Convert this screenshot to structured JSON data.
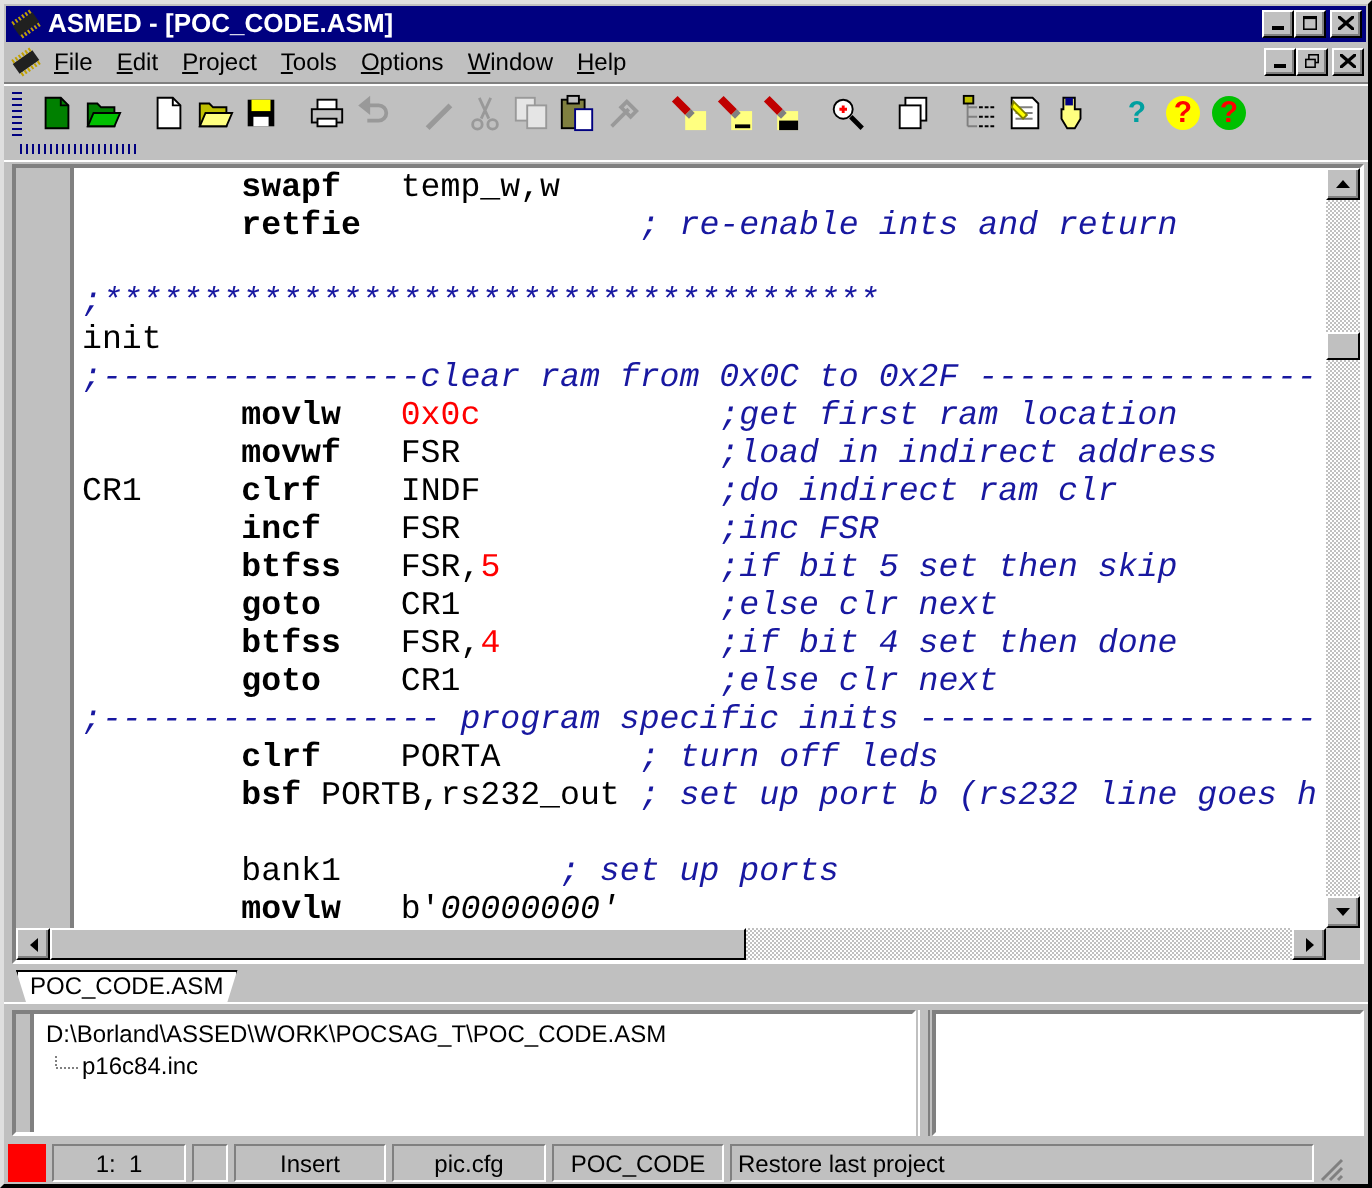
{
  "window": {
    "title": "ASMED - [POC_CODE.ASM]"
  },
  "menu": [
    "File",
    "Edit",
    "Project",
    "Tools",
    "Options",
    "Window",
    "Help"
  ],
  "toolbar": [
    [
      {
        "kind": "new-green",
        "disabled": false
      },
      {
        "kind": "open-green",
        "disabled": false
      }
    ],
    [
      {
        "kind": "new",
        "disabled": false
      },
      {
        "kind": "open",
        "disabled": false
      },
      {
        "kind": "save",
        "disabled": false
      }
    ],
    [
      {
        "kind": "print",
        "disabled": false
      },
      {
        "kind": "undo",
        "disabled": true
      }
    ],
    [
      {
        "kind": "pen",
        "disabled": true
      },
      {
        "kind": "cut",
        "disabled": true
      },
      {
        "kind": "copy",
        "disabled": true
      },
      {
        "kind": "paste",
        "disabled": false
      },
      {
        "kind": "brush",
        "disabled": true
      }
    ],
    [
      {
        "kind": "find",
        "disabled": false
      },
      {
        "kind": "find-next",
        "disabled": false
      },
      {
        "kind": "replace",
        "disabled": false
      }
    ],
    [
      {
        "kind": "zoom",
        "disabled": false
      }
    ],
    [
      {
        "kind": "windows",
        "disabled": false
      }
    ],
    [
      {
        "kind": "tree",
        "disabled": false
      },
      {
        "kind": "project",
        "disabled": false
      },
      {
        "kind": "pointer",
        "disabled": false
      }
    ],
    [
      {
        "kind": "help",
        "glyph": "?",
        "disabled": false
      },
      {
        "kind": "help-red",
        "glyph": "?",
        "disabled": false
      },
      {
        "kind": "help-green",
        "glyph": "?",
        "disabled": false
      }
    ]
  ],
  "editor": {
    "lines": [
      {
        "kind": "code",
        "segments": [
          {
            "kind": "op",
            "text": "        swapf"
          },
          {
            "kind": "arg",
            "text": "   temp_w,w"
          }
        ]
      },
      {
        "kind": "code",
        "segments": [
          {
            "kind": "op",
            "text": "        retfie"
          },
          {
            "kind": "comment",
            "text": "              ; re-enable ints and return"
          }
        ]
      },
      {
        "kind": "blank"
      },
      {
        "kind": "code",
        "segments": [
          {
            "kind": "comment",
            "text": ";***************************************"
          }
        ]
      },
      {
        "kind": "code",
        "segments": [
          {
            "kind": "label",
            "text": "init"
          }
        ]
      },
      {
        "kind": "code",
        "segments": [
          {
            "kind": "comment",
            "text": ";----------------clear ram from 0x0C to 0x2F -----------------"
          }
        ]
      },
      {
        "kind": "code",
        "segments": [
          {
            "kind": "op",
            "text": "        movlw"
          },
          {
            "kind": "num",
            "text": "   0x0c"
          },
          {
            "kind": "comment",
            "text": "            ;get first ram location"
          }
        ]
      },
      {
        "kind": "code",
        "segments": [
          {
            "kind": "op",
            "text": "        movwf"
          },
          {
            "kind": "arg",
            "text": "   FSR"
          },
          {
            "kind": "comment",
            "text": "             ;load in indirect address"
          }
        ]
      },
      {
        "kind": "code",
        "segments": [
          {
            "kind": "label",
            "text": "CR1"
          },
          {
            "kind": "op",
            "text": "     clrf"
          },
          {
            "kind": "arg",
            "text": "    INDF"
          },
          {
            "kind": "comment",
            "text": "            ;do indirect ram clr"
          }
        ]
      },
      {
        "kind": "code",
        "segments": [
          {
            "kind": "op",
            "text": "        incf"
          },
          {
            "kind": "arg",
            "text": "    FSR"
          },
          {
            "kind": "comment",
            "text": "             ;inc FSR"
          }
        ]
      },
      {
        "kind": "code",
        "segments": [
          {
            "kind": "op",
            "text": "        btfss"
          },
          {
            "kind": "arg",
            "text": "   FSR,"
          },
          {
            "kind": "num",
            "text": "5"
          },
          {
            "kind": "comment",
            "text": "           ;if bit 5 set then skip"
          }
        ]
      },
      {
        "kind": "code",
        "segments": [
          {
            "kind": "op",
            "text": "        goto"
          },
          {
            "kind": "arg",
            "text": "    CR1"
          },
          {
            "kind": "comment",
            "text": "             ;else clr next"
          }
        ]
      },
      {
        "kind": "code",
        "segments": [
          {
            "kind": "op",
            "text": "        btfss"
          },
          {
            "kind": "arg",
            "text": "   FSR,"
          },
          {
            "kind": "num",
            "text": "4"
          },
          {
            "kind": "comment",
            "text": "           ;if bit 4 set then done"
          }
        ]
      },
      {
        "kind": "code",
        "segments": [
          {
            "kind": "op",
            "text": "        goto"
          },
          {
            "kind": "arg",
            "text": "    CR1"
          },
          {
            "kind": "comment",
            "text": "             ;else clr next"
          }
        ]
      },
      {
        "kind": "code",
        "segments": [
          {
            "kind": "comment",
            "text": ";----------------- program specific inits --------------------"
          }
        ]
      },
      {
        "kind": "code",
        "segments": [
          {
            "kind": "op",
            "text": "        clrf"
          },
          {
            "kind": "arg",
            "text": "    PORTA"
          },
          {
            "kind": "comment",
            "text": "       ; turn off leds"
          }
        ]
      },
      {
        "kind": "code",
        "segments": [
          {
            "kind": "op",
            "text": "        bsf"
          },
          {
            "kind": "arg",
            "text": " PORTB,rs232_out"
          },
          {
            "kind": "comment",
            "text": " ; set up port b (rs232 line goes h"
          }
        ]
      },
      {
        "kind": "blank"
      },
      {
        "kind": "code",
        "segments": [
          {
            "kind": "arg",
            "text": "        bank1"
          },
          {
            "kind": "comment",
            "text": "           ; set up ports"
          }
        ]
      },
      {
        "kind": "code",
        "segments": [
          {
            "kind": "op",
            "text": "        movlw"
          },
          {
            "kind": "arg",
            "text": "   b'"
          },
          {
            "kind": "str",
            "text": "00000000'"
          }
        ]
      }
    ]
  },
  "tabs": [
    {
      "label": "POC_CODE.ASM",
      "selected": true
    }
  ],
  "project_tree": {
    "label": "D:\\Borland\\ASSED\\WORK\\POCSAG_T\\POC_CODE.ASM",
    "children": [
      {
        "label": "p16c84.inc"
      }
    ]
  },
  "status_bar": {
    "position": "1:  1",
    "mode": "Insert",
    "config": "pic.cfg",
    "project": "POC_CODE",
    "message": "Restore last project"
  }
}
